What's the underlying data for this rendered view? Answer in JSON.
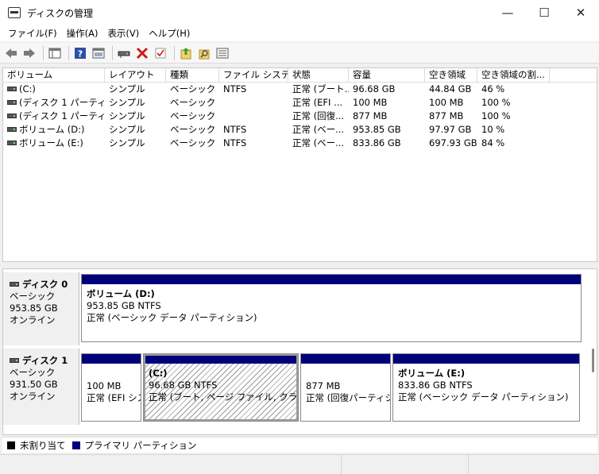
{
  "window": {
    "title": "ディスクの管理",
    "minimize": "—",
    "maximize": "☐",
    "close": "✕"
  },
  "menu": [
    {
      "label": "ファイル(F)"
    },
    {
      "label": "操作(A)"
    },
    {
      "label": "表示(V)"
    },
    {
      "label": "ヘルプ(H)"
    }
  ],
  "toolbar": {
    "icons": [
      "back-icon",
      "forward-icon",
      "console-tree-icon",
      "help-icon",
      "show-pane-icon",
      "connect-drive-icon",
      "delete-icon",
      "properties-icon",
      "import-icon",
      "rescan-icon",
      "settings-list-icon"
    ]
  },
  "list": {
    "columns": [
      {
        "label": "ボリューム"
      },
      {
        "label": "レイアウト"
      },
      {
        "label": "種類"
      },
      {
        "label": "ファイル システム"
      },
      {
        "label": "状態"
      },
      {
        "label": "容量"
      },
      {
        "label": "空き領域"
      },
      {
        "label": "空き領域の割..."
      }
    ],
    "rows": [
      {
        "volume": "(C:)",
        "layout": "シンプル",
        "type": "ベーシック",
        "fs": "NTFS",
        "status": "正常 (ブート...",
        "capacity": "96.68 GB",
        "free": "44.84 GB",
        "pct": "46 %"
      },
      {
        "volume": "(ディスク 1 パーティシ...",
        "layout": "シンプル",
        "type": "ベーシック",
        "fs": "",
        "status": "正常 (EFI ...",
        "capacity": "100 MB",
        "free": "100 MB",
        "pct": "100 %"
      },
      {
        "volume": "(ディスク 1 パーティシ...",
        "layout": "シンプル",
        "type": "ベーシック",
        "fs": "",
        "status": "正常 (回復...",
        "capacity": "877 MB",
        "free": "877 MB",
        "pct": "100 %"
      },
      {
        "volume": "ボリューム (D:)",
        "layout": "シンプル",
        "type": "ベーシック",
        "fs": "NTFS",
        "status": "正常 (ベー...",
        "capacity": "953.85 GB",
        "free": "97.97 GB",
        "pct": "10 %"
      },
      {
        "volume": "ボリューム (E:)",
        "layout": "シンプル",
        "type": "ベーシック",
        "fs": "NTFS",
        "status": "正常 (ベー...",
        "capacity": "833.86 GB",
        "free": "697.93 GB",
        "pct": "84 %"
      }
    ]
  },
  "disks": [
    {
      "name": "ディスク 0",
      "kind": "ベーシック",
      "size": "953.85 GB",
      "state": "オンライン",
      "partitions": [
        {
          "name": "ボリューム (D:)",
          "size": "953.85 GB NTFS",
          "status": "正常 (ベーシック データ パーティション)"
        }
      ]
    },
    {
      "name": "ディスク 1",
      "kind": "ベーシック",
      "size": "931.50 GB",
      "state": "オンライン",
      "partitions": [
        {
          "name": "",
          "size": "100 MB",
          "status": "正常 (EFI シス"
        },
        {
          "name": "(C:)",
          "size": "96.68 GB NTFS",
          "status": "正常 (ブート, ページ ファイル, クラッシュ ダ"
        },
        {
          "name": "",
          "size": "877 MB",
          "status": "正常 (回復パーティシ"
        },
        {
          "name": "ボリューム (E:)",
          "size": "833.86 GB NTFS",
          "status": "正常 (ベーシック データ パーティション)"
        }
      ]
    }
  ],
  "legend": [
    {
      "label": "未割り当て",
      "color": "#000000"
    },
    {
      "label": "プライマリ パーティション",
      "color": "#00007b"
    }
  ]
}
